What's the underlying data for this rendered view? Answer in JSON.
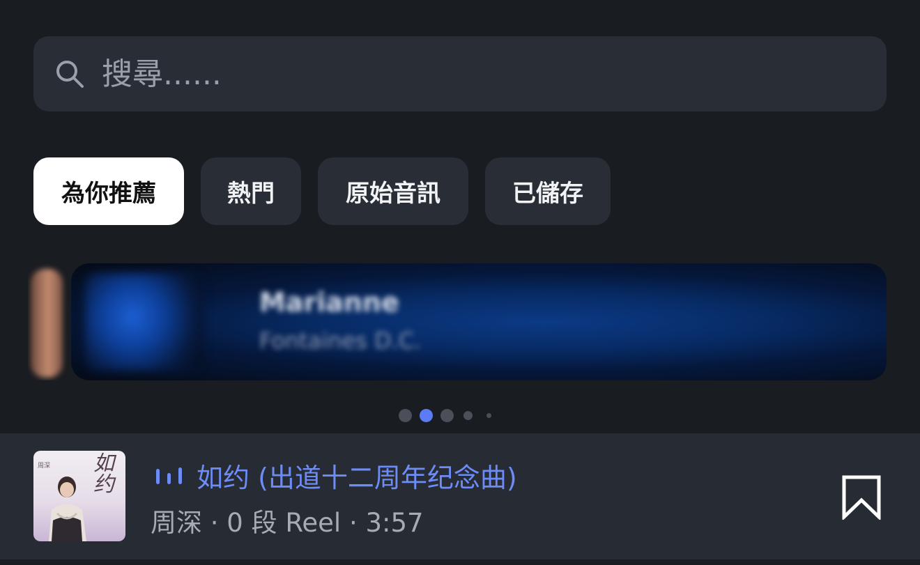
{
  "search": {
    "placeholder": "搜尋......",
    "icon": "search-icon"
  },
  "tabs": [
    {
      "label": "為你推薦",
      "active": true
    },
    {
      "label": "熱門",
      "active": false
    },
    {
      "label": "原始音訊",
      "active": false
    },
    {
      "label": "已儲存",
      "active": false
    }
  ],
  "banner": {
    "title": "Marianne",
    "subtitle": "Fontaines D.C."
  },
  "carousel": {
    "dot_count": 5,
    "active_index": 1
  },
  "now_playing": {
    "title": "如约 (出道十二周年纪念曲)",
    "meta": "周深 · 0 段 Reel · 3:57",
    "album_art_text": "如约",
    "album_art_small": "周深",
    "playing_icon": "equalizer-icon",
    "bookmark_icon": "bookmark-icon"
  },
  "colors": {
    "background": "#191c21",
    "surface": "#282d36",
    "accent": "#6d8cf5",
    "active_tab_bg": "#ffffff"
  }
}
